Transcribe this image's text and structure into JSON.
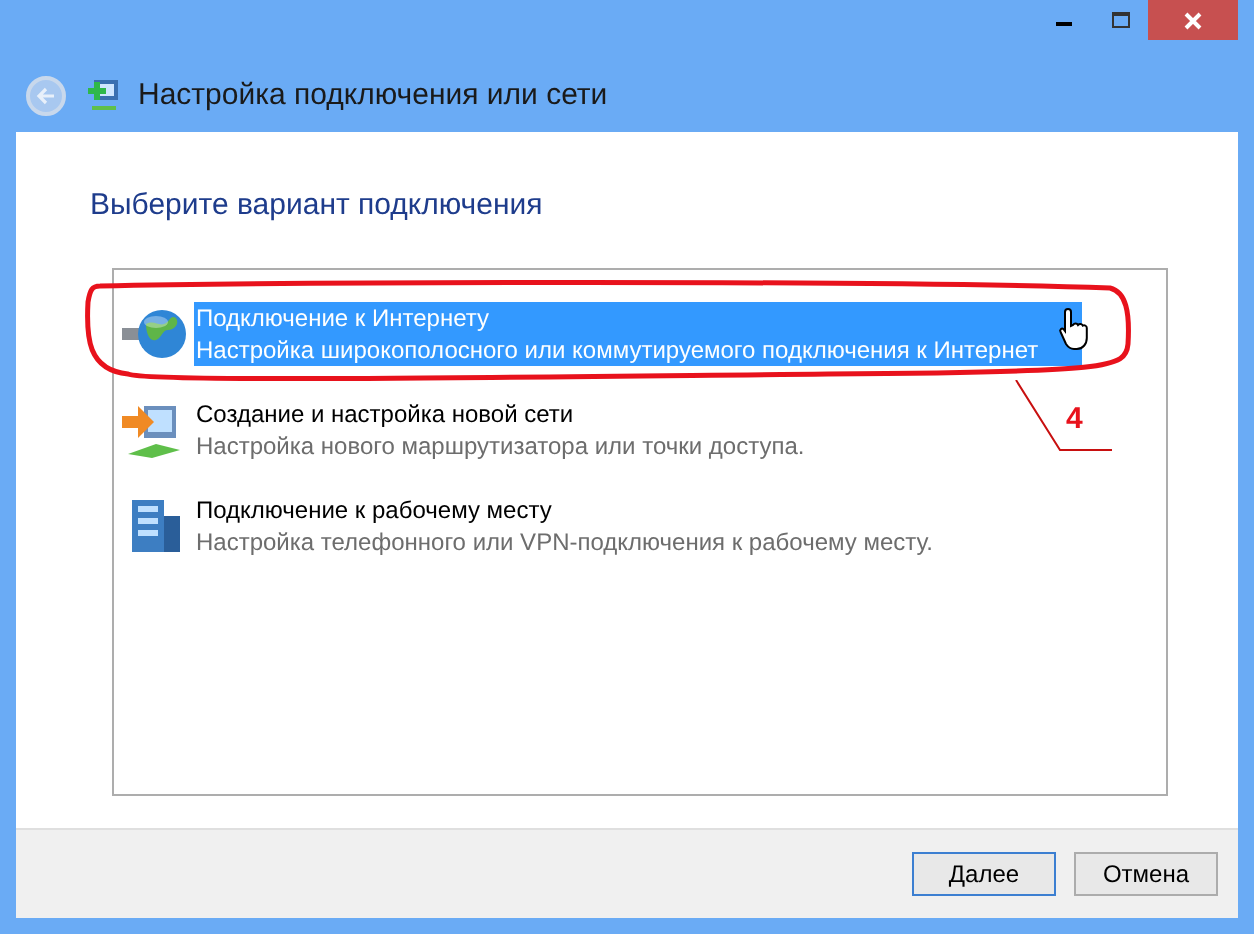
{
  "window": {
    "title": "Настройка подключения или сети"
  },
  "heading": "Выберите вариант подключения",
  "options": [
    {
      "kind": "internet",
      "title": "Подключение к Интернету",
      "description": "Настройка широкополосного или коммутируемого подключения к Интернет",
      "selected": true
    },
    {
      "kind": "network",
      "title": "Создание и настройка новой сети",
      "description": "Настройка нового маршрутизатора или точки доступа.",
      "selected": false
    },
    {
      "kind": "workplace",
      "title": "Подключение к рабочему месту",
      "description": "Настройка телефонного или VPN-подключения к рабочему месту.",
      "selected": false
    }
  ],
  "annotation": {
    "label": "4"
  },
  "buttons": [
    {
      "label": "Далее",
      "default": true
    },
    {
      "label": "Отмена",
      "default": false
    }
  ]
}
